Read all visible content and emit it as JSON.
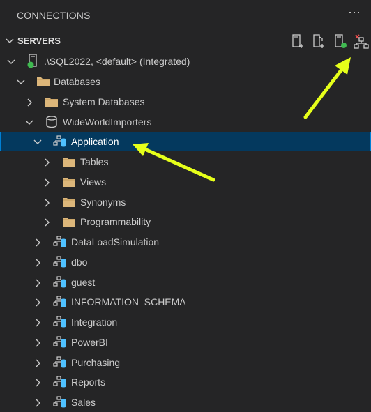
{
  "panel": {
    "title": "CONNECTIONS",
    "more_label": "⋯"
  },
  "servers_header": {
    "label": "SERVERS"
  },
  "toolbar": {
    "actions": [
      {
        "icon": "new-connection-icon"
      },
      {
        "icon": "new-server-group-icon"
      },
      {
        "icon": "active-connections-icon"
      },
      {
        "icon": "disconnect-icon"
      }
    ]
  },
  "tree": {
    "server": ".\\SQL2022, <default> (Integrated)",
    "databases_folder": "Databases",
    "system_databases": "System Databases",
    "database": "WideWorldImporters",
    "selected_schema": "Application",
    "schema_children": [
      "Tables",
      "Views",
      "Synonyms",
      "Programmability"
    ],
    "other_schemas": [
      "DataLoadSimulation",
      "dbo",
      "guest",
      "INFORMATION_SCHEMA",
      "Integration",
      "PowerBI",
      "Purchasing",
      "Reports",
      "Sales"
    ]
  },
  "colors": {
    "background": "#252526",
    "selection": "#04395e",
    "selection_border": "#007fd4",
    "folder": "#dcb67a",
    "db_blue": "#4fc1ff",
    "status_green": "#3fb950",
    "annotation_arrow": "#e6ff1a"
  }
}
